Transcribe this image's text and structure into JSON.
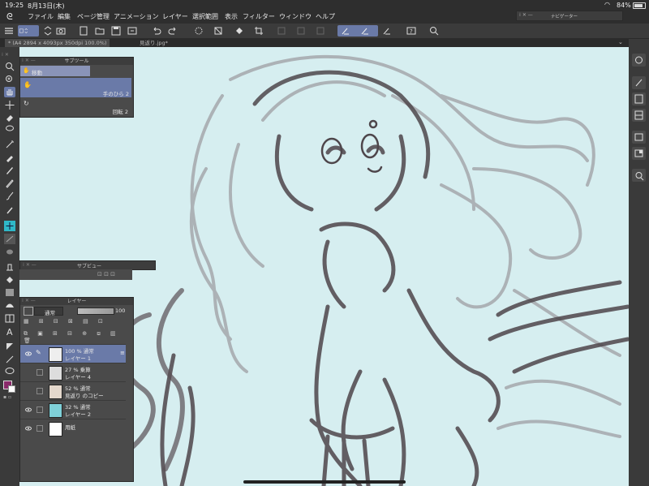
{
  "status": {
    "time": "19:25",
    "date": "8月13日(木)",
    "battery": "84%"
  },
  "menu": [
    "ファイル",
    "編集",
    "ページ管理",
    "アニメーション",
    "レイヤー",
    "選択範囲",
    "表示",
    "フィルター",
    "ウィンドウ",
    "ヘルプ"
  ],
  "navigator": {
    "title": "ナビゲーター"
  },
  "tabs": [
    {
      "label": "* (A4 2894 x 4093px 350dpi 100.0%)"
    },
    {
      "label": "見返り.jpg*"
    }
  ],
  "subtool": {
    "title": "サブツール",
    "group": "移動",
    "items": [
      {
        "label": "手のひら 2"
      },
      {
        "label": "回転 2"
      }
    ]
  },
  "subview": {
    "title": "サブビュー"
  },
  "layers": {
    "title": "レイヤー",
    "blend_mode": "通常",
    "opacity": "100",
    "rows": [
      {
        "line1": "100 % 通常",
        "line2": "レイヤー 1",
        "selected": true
      },
      {
        "line1": "27 % 乗算",
        "line2": "レイヤー 4",
        "selected": false
      },
      {
        "line1": "52 % 通常",
        "line2": "見返り のコピー",
        "selected": false
      },
      {
        "line1": "32 % 通常",
        "line2": "レイヤー 2",
        "selected": false
      },
      {
        "line1": "",
        "line2": "用紙",
        "selected": false
      }
    ]
  },
  "colors": {
    "canvas": "#d6eef0",
    "accent": "#6a7aa8",
    "ui_dark": "#2e2e2e",
    "ui_panel": "#4a4a4a"
  }
}
